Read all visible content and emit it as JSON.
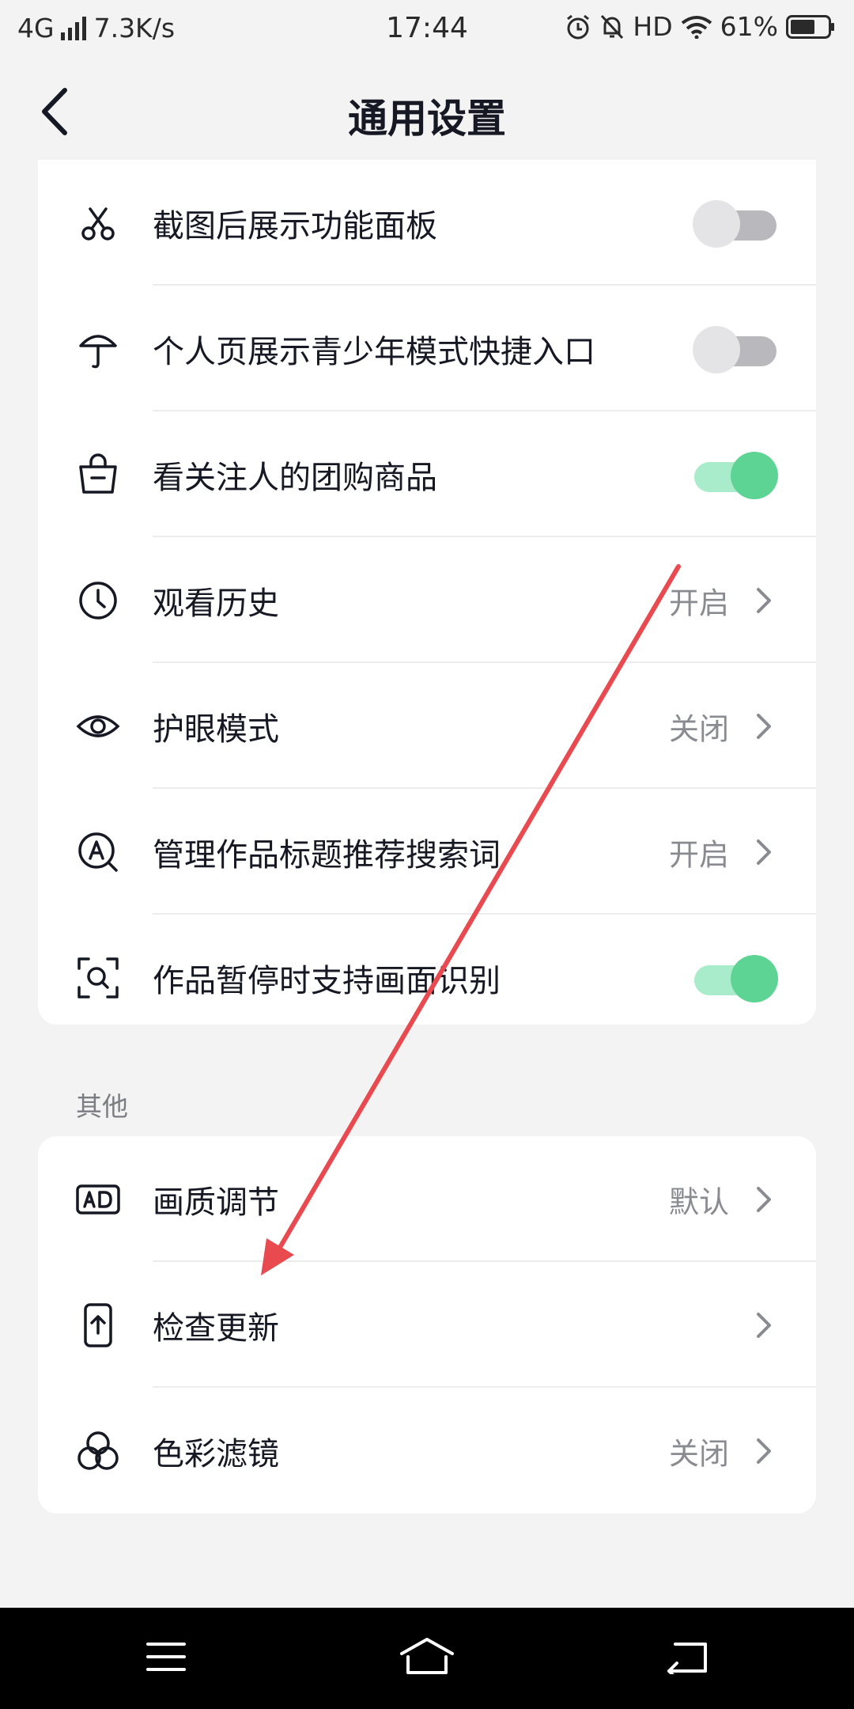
{
  "status_bar": {
    "network": "4G",
    "speed": "7.3K/s",
    "time": "17:44",
    "hd": "HD",
    "battery": "61%"
  },
  "header": {
    "title": "通用设置",
    "back_icon": "back-chevron-icon"
  },
  "settings_group_1": [
    {
      "icon": "scissors-icon",
      "label": "截图后展示功能面板",
      "control": "toggle",
      "on": false
    },
    {
      "icon": "umbrella-icon",
      "label": "个人页展示青少年模式快捷入口",
      "control": "toggle",
      "on": false
    },
    {
      "icon": "shopping-bag-icon",
      "label": "看关注人的团购商品",
      "control": "toggle",
      "on": true
    },
    {
      "icon": "clock-icon",
      "label": "观看历史",
      "control": "link",
      "value": "开启"
    },
    {
      "icon": "eye-icon",
      "label": "护眼模式",
      "control": "link",
      "value": "关闭"
    },
    {
      "icon": "search-a-icon",
      "label": "管理作品标题推荐搜索词",
      "control": "link",
      "value": "开启"
    },
    {
      "icon": "scan-icon",
      "label": "作品暂停时支持画面识别",
      "control": "toggle",
      "on": true
    }
  ],
  "section_other": {
    "title": "其他"
  },
  "settings_group_2": [
    {
      "icon": "ad-icon",
      "label": "画质调节",
      "control": "link",
      "value": "默认"
    },
    {
      "icon": "phone-upload-icon",
      "label": "检查更新",
      "control": "link",
      "value": ""
    },
    {
      "icon": "color-filter-icon",
      "label": "色彩滤镜",
      "control": "link",
      "value": "关闭"
    }
  ],
  "colors": {
    "toggle_on_track": "#a8eccb",
    "toggle_on_knob": "#5ed494",
    "toggle_off_track": "#b9b9bd",
    "annotation_arrow": "#e84a4f"
  },
  "nav_bar": {
    "icons": [
      "menu-icon",
      "home-icon",
      "back-icon"
    ]
  }
}
